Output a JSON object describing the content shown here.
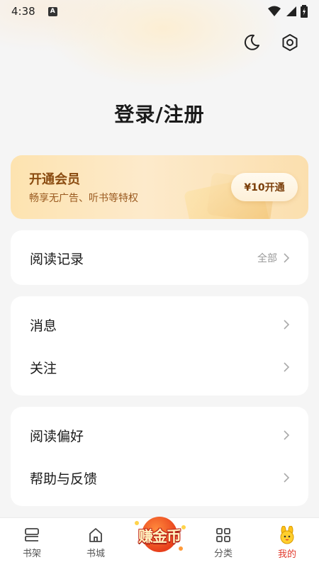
{
  "status_bar": {
    "time": "4:38",
    "indicator": "A"
  },
  "header": {
    "night_mode_icon": "moon-icon",
    "settings_icon": "gear-icon"
  },
  "login": {
    "title": "登录/注册"
  },
  "vip": {
    "title": "开通会员",
    "subtitle": "畅享无广告、听书等特权",
    "button_label": "¥10开通"
  },
  "history": {
    "label": "阅读记录",
    "extra": "全部"
  },
  "menu_group_1": [
    {
      "label": "消息"
    },
    {
      "label": "关注"
    }
  ],
  "menu_group_2": [
    {
      "label": "阅读偏好"
    },
    {
      "label": "帮助与反馈"
    }
  ],
  "bottom_nav": {
    "items": [
      {
        "label": "书架",
        "icon": "bookshelf-icon"
      },
      {
        "label": "书城",
        "icon": "home-icon"
      },
      {
        "label": "赚金币",
        "icon": "earn-coins-icon"
      },
      {
        "label": "分类",
        "icon": "grid-icon"
      },
      {
        "label": "我的",
        "icon": "mascot-icon",
        "active": true
      }
    ]
  },
  "colors": {
    "accent": "#e23b2e",
    "vip_text": "#8a4b10",
    "background": "#f5f5f5"
  }
}
